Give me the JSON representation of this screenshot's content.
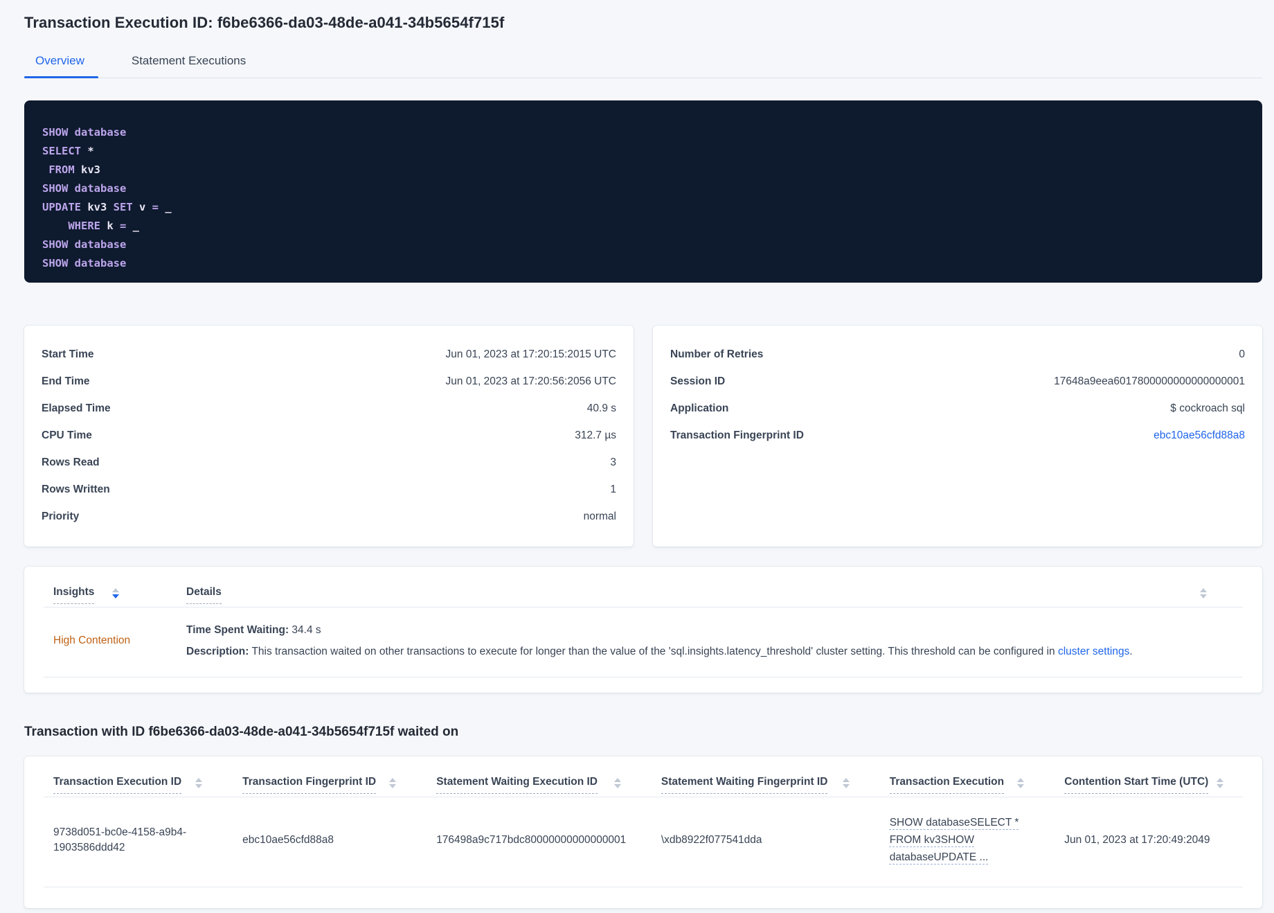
{
  "colors": {
    "accent": "#2065e9",
    "text": "#394455",
    "heading": "#242a35",
    "page_bg": "#f5f7fa",
    "code_bg": "#0e1a2e",
    "code_kw": "#bda6ec",
    "code_id": "#e9e6f4",
    "orange": "#bf6114",
    "border": "#e4e9f0",
    "arrow": "#c0c8d4",
    "dash": "#9aa9bd"
  },
  "header": {
    "title": "Transaction Execution ID: f6be6366-da03-48de-a041-34b5654f715f",
    "tabs": {
      "overview": "Overview",
      "statement_executions": "Statement Executions"
    }
  },
  "sql_box": {
    "lines": [
      {
        "parts": [
          {
            "text": "SHOW database",
            "type": "kw"
          }
        ]
      },
      {
        "parts": [
          {
            "text": "SELECT",
            "type": "kw"
          },
          {
            "text": " *",
            "type": "id"
          }
        ]
      },
      {
        "parts": [
          {
            "text": " ",
            "type": "id"
          },
          {
            "text": "FROM",
            "type": "kw"
          },
          {
            "text": " kv3",
            "type": "id"
          }
        ]
      },
      {
        "parts": [
          {
            "text": "SHOW database",
            "type": "kw"
          }
        ]
      },
      {
        "parts": [
          {
            "text": "UPDATE",
            "type": "kw"
          },
          {
            "text": " kv3 ",
            "type": "id"
          },
          {
            "text": "SET",
            "type": "kw"
          },
          {
            "text": " v ",
            "type": "id"
          },
          {
            "text": "=",
            "type": "kw"
          },
          {
            "text": " _",
            "type": "id"
          }
        ]
      },
      {
        "parts": [
          {
            "text": "    ",
            "type": "id"
          },
          {
            "text": "WHERE",
            "type": "kw"
          },
          {
            "text": " k ",
            "type": "id"
          },
          {
            "text": "=",
            "type": "kw"
          },
          {
            "text": " _",
            "type": "id"
          }
        ]
      },
      {
        "parts": [
          {
            "text": "SHOW database",
            "type": "kw"
          }
        ]
      },
      {
        "parts": [
          {
            "text": "SHOW database",
            "type": "kw"
          }
        ]
      }
    ]
  },
  "summary_left": {
    "rows": [
      {
        "label": "Start Time",
        "value": "Jun 01, 2023 at 17:20:15:2015 UTC"
      },
      {
        "label": "End Time",
        "value": "Jun 01, 2023 at 17:20:56:2056 UTC"
      },
      {
        "label": "Elapsed Time",
        "value": "40.9 s"
      },
      {
        "label": "CPU Time",
        "value": "312.7 µs"
      },
      {
        "label": "Rows Read",
        "value": "3"
      },
      {
        "label": "Rows Written",
        "value": "1"
      },
      {
        "label": "Priority",
        "value": "normal"
      }
    ]
  },
  "summary_right": {
    "rows": [
      {
        "label": "Number of Retries",
        "value": "0"
      },
      {
        "label": "Session ID",
        "value": "17648a9eea6017800000000000000001"
      },
      {
        "label": "Application",
        "value": "$ cockroach sql"
      },
      {
        "label": "Transaction Fingerprint ID",
        "value": "ebc10ae56cfd88a8"
      }
    ]
  },
  "insights": {
    "headers": {
      "insights": "Insights",
      "details": "Details"
    },
    "row": {
      "insight": "High Contention",
      "waiting_label": "Time Spent Waiting:",
      "waiting_value": " 34.4 s",
      "description_label": "Description:",
      "description_text": " This transaction waited on other transactions to execute for longer than the value of the 'sql.insights.latency_threshold' cluster setting. This threshold can be configured in ",
      "description_link": "cluster settings",
      "description_suffix": "."
    }
  },
  "waited_on": {
    "heading": "Transaction with ID f6be6366-da03-48de-a041-34b5654f715f waited on",
    "columns": [
      "Transaction Execution ID",
      "Transaction Fingerprint ID",
      "Statement Waiting Execution ID",
      "Statement Waiting Fingerprint ID",
      "Transaction Execution",
      "Contention Start Time (UTC)"
    ],
    "row": {
      "transaction_execution_id": "9738d051-bc0e-4158-a9b4-1903586ddd42",
      "transaction_fingerprint_id": "ebc10ae56cfd88a8",
      "statement_waiting_execution_id": "176498a9c717bdc80000000000000001",
      "statement_waiting_fingerprint_id": "\\xdb8922f077541dda",
      "transaction_execution": "SHOW databaseSELECT * FROM kv3SHOW databaseUPDATE ...",
      "contention_start_time": "Jun 01, 2023 at 17:20:49:2049"
    }
  }
}
